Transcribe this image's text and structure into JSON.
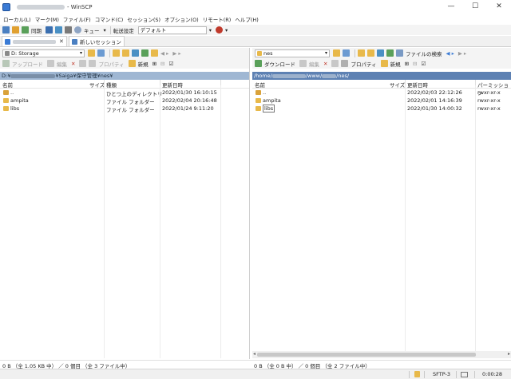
{
  "window": {
    "title": "WinSCP",
    "controls": [
      "minimize-icon",
      "maximize-icon",
      "close-icon"
    ]
  },
  "menu": [
    "ローカル(L)",
    "マーク(M)",
    "ファイル(F)",
    "コマンド(C)",
    "セッション(S)",
    "オプション(O)",
    "リモート(R)",
    "ヘルプ(H)"
  ],
  "toolbar": {
    "sync_label": "同期",
    "queue_label": "キュー",
    "transfer_label": "転送設定",
    "preset_value": "デフォルト"
  },
  "tabs": {
    "session_close": "✕",
    "new_session": "新しいセッション"
  },
  "left": {
    "drive": "D: Storage",
    "upload": "アップロード",
    "edit": "編集",
    "properties": "プロパティ",
    "new": "新規",
    "path_prefix": "D:¥",
    "path_suffix": "¥Saiga¥保守管理¥nes¥",
    "columns": {
      "name": "名前",
      "size": "サイズ",
      "type": "種類",
      "modified": "更新日時"
    },
    "rows": [
      {
        "name": "..",
        "type": "ひとつ上のディレクトリ",
        "modified": "2022/01/30  16:10:15"
      },
      {
        "name": "ampita",
        "type": "ファイル フォルダー",
        "modified": "2022/02/04  20:16:48"
      },
      {
        "name": "libs",
        "type": "ファイル フォルダー",
        "modified": "2022/01/24  9:11:20"
      }
    ],
    "status": "0 B （全 1.05 KB 中） ／ 0 個目 （全 3 ファイル中）"
  },
  "right": {
    "dir": "nes",
    "find_files": "ファイルの検索",
    "download": "ダウンロード",
    "edit": "編集",
    "properties": "プロパティ",
    "new": "新規",
    "path_prefix": "/home/",
    "path_mid": "/www/",
    "path_suffix": "/nes/",
    "columns": {
      "name": "名前",
      "size": "サイズ",
      "modified": "更新日時",
      "perms": "パーミッション"
    },
    "rows": [
      {
        "name": "..",
        "modified": "2022/02/03 22:12:26",
        "perms": "rwxr-xr-x"
      },
      {
        "name": "ampita",
        "modified": "2022/02/01 14:16:39",
        "perms": "rwxr-xr-x"
      },
      {
        "name": "libs",
        "modified": "2022/01/30 14:00:32",
        "perms": "rwxr-xr-x"
      }
    ],
    "status": "0 B （全 0 B 中） ／ 0 個目 （全 2 ファイル中）"
  },
  "bottom": {
    "protocol": "SFTP-3",
    "elapsed": "0:00:28"
  },
  "colors": {
    "left_path_bg": "#9fb7d3",
    "right_path_bg": "#5d81b3",
    "folder": "#e8b94a"
  }
}
